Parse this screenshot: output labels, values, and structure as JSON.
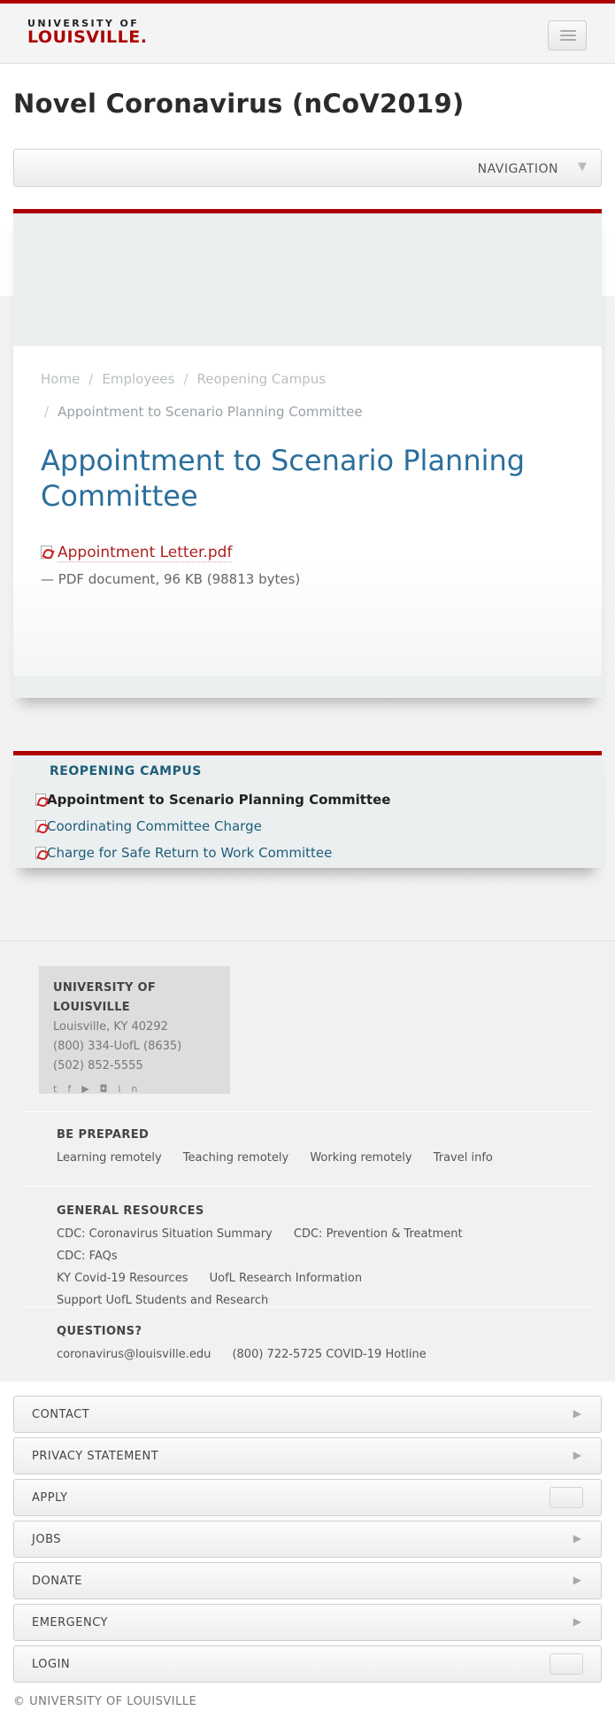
{
  "header": {
    "logo_line1": "UNIVERSITY OF",
    "logo_line2": "LOUISVILLE.",
    "page_title": "Novel Coronavirus (nCoV2019)",
    "nav_label": "NAVIGATION"
  },
  "breadcrumb": {
    "items": [
      "Home",
      "Employees",
      "Reopening Campus"
    ],
    "current": "Appointment to Scenario Planning Committee"
  },
  "document": {
    "title": "Appointment to Scenario Planning Committee",
    "file_link": "Appointment Letter.pdf",
    "file_meta": "— PDF document, 96 KB (98813 bytes)"
  },
  "sidebar": {
    "title": "REOPENING CAMPUS",
    "items": [
      "Appointment to Scenario Planning Committee",
      "Coordinating Committee Charge",
      "Charge for Safe Return to Work Committee"
    ]
  },
  "footer": {
    "org": "UNIVERSITY OF LOUISVILLE",
    "address": "Louisville, KY 40292",
    "phone1": "(800) 334-UofL (8635)",
    "phone2": "(502) 852-5555",
    "social": [
      "twitter-icon",
      "facebook-icon",
      "youtube-icon",
      "instagram-icon",
      "linkedin-icon"
    ],
    "be_prepared": {
      "title": "BE PREPARED",
      "links": [
        "Learning remotely",
        "Teaching remotely",
        "Working remotely",
        "Travel info"
      ]
    },
    "general_resources": {
      "title": "GENERAL RESOURCES",
      "links": [
        "CDC: Coronavirus Situation Summary",
        "CDC: Prevention & Treatment",
        "CDC: FAQs",
        "KY Covid-19 Resources",
        "UofL Research Information",
        "Support UofL Students and Research"
      ]
    },
    "questions": {
      "title": "QUESTIONS?",
      "links": [
        "coronavirus@louisville.edu",
        "(800) 722-5725 COVID-19 Hotline"
      ]
    }
  },
  "accordion": [
    "CONTACT",
    "PRIVACY STATEMENT",
    "APPLY",
    "JOBS",
    "DONATE",
    "EMERGENCY",
    "LOGIN"
  ],
  "copyright": "© UNIVERSITY OF LOUISVILLE",
  "colors": {
    "brand_red": "#ad0000",
    "link_blue": "#2a6f9c"
  }
}
